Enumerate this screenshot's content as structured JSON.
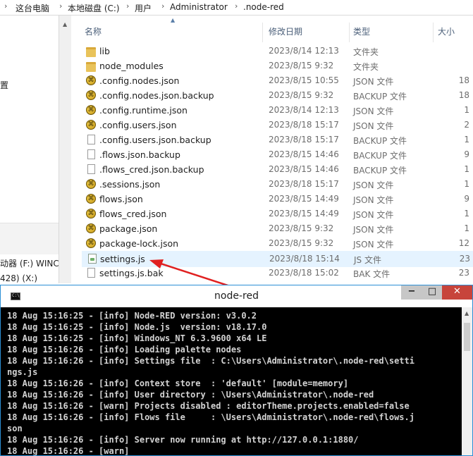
{
  "breadcrumb": [
    "这台电脑",
    "本地磁盘 (C:)",
    "用户",
    "Administrator",
    ".node-red"
  ],
  "nav": {
    "items": [
      "置",
      "动器 (F:) WINCC",
      "428) (X:)"
    ]
  },
  "columns": {
    "name": "名称",
    "modified": "修改日期",
    "type": "类型",
    "size": "大小"
  },
  "files": [
    {
      "name": "lib",
      "date": "2023/8/14 12:13",
      "type": "文件夹",
      "size": "",
      "icon": "folder-icon"
    },
    {
      "name": "node_modules",
      "date": "2023/8/15 9:32",
      "type": "文件夹",
      "size": "",
      "icon": "folder-icon"
    },
    {
      "name": ".config.nodes.json",
      "date": "2023/8/15 10:55",
      "type": "JSON 文件",
      "size": "18",
      "icon": "json-file-icon"
    },
    {
      "name": ".config.nodes.json.backup",
      "date": "2023/8/15 9:32",
      "type": "BACKUP 文件",
      "size": "18",
      "icon": "json-file-icon"
    },
    {
      "name": ".config.runtime.json",
      "date": "2023/8/14 12:13",
      "type": "JSON 文件",
      "size": "1",
      "icon": "json-file-icon"
    },
    {
      "name": ".config.users.json",
      "date": "2023/8/18 15:17",
      "type": "JSON 文件",
      "size": "2",
      "icon": "json-file-icon"
    },
    {
      "name": ".config.users.json.backup",
      "date": "2023/8/18 15:17",
      "type": "BACKUP 文件",
      "size": "1",
      "icon": "blank-file-icon"
    },
    {
      "name": ".flows.json.backup",
      "date": "2023/8/15 14:46",
      "type": "BACKUP 文件",
      "size": "9",
      "icon": "blank-file-icon"
    },
    {
      "name": ".flows_cred.json.backup",
      "date": "2023/8/15 14:46",
      "type": "BACKUP 文件",
      "size": "1",
      "icon": "blank-file-icon"
    },
    {
      "name": ".sessions.json",
      "date": "2023/8/18 15:17",
      "type": "JSON 文件",
      "size": "1",
      "icon": "json-file-icon"
    },
    {
      "name": "flows.json",
      "date": "2023/8/15 14:49",
      "type": "JSON 文件",
      "size": "9",
      "icon": "json-file-icon"
    },
    {
      "name": "flows_cred.json",
      "date": "2023/8/15 14:49",
      "type": "JSON 文件",
      "size": "1",
      "icon": "json-file-icon"
    },
    {
      "name": "package.json",
      "date": "2023/8/15 9:32",
      "type": "JSON 文件",
      "size": "1",
      "icon": "json-file-icon"
    },
    {
      "name": "package-lock.json",
      "date": "2023/8/15 9:32",
      "type": "JSON 文件",
      "size": "12",
      "icon": "json-file-icon"
    },
    {
      "name": "settings.js",
      "date": "2023/8/18 15:14",
      "type": "JS 文件",
      "size": "23",
      "icon": "js-file-icon"
    },
    {
      "name": "settings.js.bak",
      "date": "2023/8/18 15:02",
      "type": "BAK 文件",
      "size": "23",
      "icon": "blank-file-icon"
    }
  ],
  "console": {
    "title": "node-red",
    "lines": [
      "18 Aug 15:16:25 - [info] Node-RED version: v3.0.2",
      "18 Aug 15:16:25 - [info] Node.js  version: v18.17.0",
      "18 Aug 15:16:25 - [info] Windows_NT 6.3.9600 x64 LE",
      "18 Aug 15:16:26 - [info] Loading palette nodes",
      "18 Aug 15:16:26 - [info] Settings file  : C:\\Users\\Administrator\\.node-red\\setti",
      "ngs.js",
      "18 Aug 15:16:26 - [info] Context store  : 'default' [module=memory]",
      "18 Aug 15:16:26 - [info] User directory : \\Users\\Administrator\\.node-red",
      "18 Aug 15:16:26 - [warn] Projects disabled : editorTheme.projects.enabled=false",
      "18 Aug 15:16:26 - [info] Flows file     : \\Users\\Administrator\\.node-red\\flows.j",
      "son",
      "18 Aug 15:16:26 - [info] Server now running at http://127.0.0.1:1880/",
      "18 Aug 15:16:26 - [warn]"
    ]
  },
  "colors": {
    "selection": "#e5f3ff",
    "annotation": "#e02020",
    "console_bg": "#000000"
  }
}
